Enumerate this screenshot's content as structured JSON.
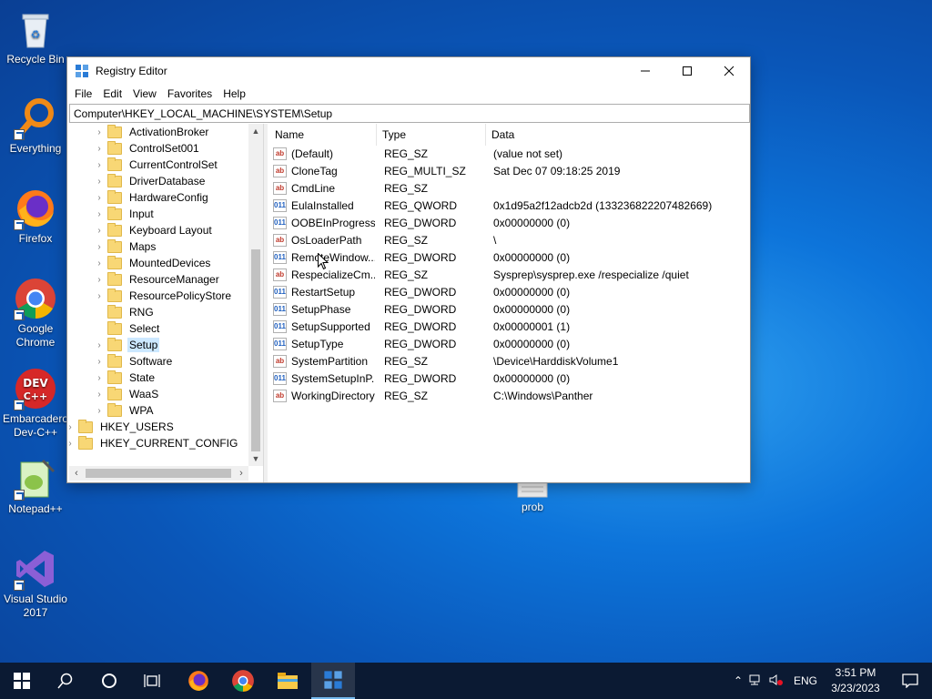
{
  "desktop": {
    "icons": [
      {
        "label": "Recycle Bin"
      },
      {
        "label": "Everything"
      },
      {
        "label": "Firefox"
      },
      {
        "label": "Google Chrome"
      },
      {
        "label": "Embarcadero Dev-C++"
      },
      {
        "label": "Notepad++"
      },
      {
        "label": "Visual Studio 2017"
      },
      {
        "label": "prob"
      }
    ]
  },
  "window": {
    "title": "Registry Editor",
    "menu": [
      "File",
      "Edit",
      "View",
      "Favorites",
      "Help"
    ],
    "address": "Computer\\HKEY_LOCAL_MACHINE\\SYSTEM\\Setup",
    "tree": [
      {
        "label": "ActivationBroker"
      },
      {
        "label": "ControlSet001"
      },
      {
        "label": "CurrentControlSet"
      },
      {
        "label": "DriverDatabase"
      },
      {
        "label": "HardwareConfig"
      },
      {
        "label": "Input"
      },
      {
        "label": "Keyboard Layout"
      },
      {
        "label": "Maps"
      },
      {
        "label": "MountedDevices"
      },
      {
        "label": "ResourceManager"
      },
      {
        "label": "ResourcePolicyStore"
      },
      {
        "label": "RNG"
      },
      {
        "label": "Select"
      },
      {
        "label": "Setup",
        "selected": true
      },
      {
        "label": "Software"
      },
      {
        "label": "State"
      },
      {
        "label": "WaaS"
      },
      {
        "label": "WPA"
      },
      {
        "label": "HKEY_USERS"
      },
      {
        "label": "HKEY_CURRENT_CONFIG"
      }
    ],
    "columns": {
      "name": "Name",
      "type": "Type",
      "data": "Data"
    },
    "values": [
      {
        "icon": "string-value-icon",
        "name": "(Default)",
        "type": "REG_SZ",
        "data": "(value not set)"
      },
      {
        "icon": "string-value-icon",
        "name": "CloneTag",
        "type": "REG_MULTI_SZ",
        "data": "Sat Dec 07 09:18:25 2019"
      },
      {
        "icon": "string-value-icon",
        "name": "CmdLine",
        "type": "REG_SZ",
        "data": ""
      },
      {
        "icon": "binary-value-icon",
        "name": "EulaInstalled",
        "type": "REG_QWORD",
        "data": "0x1d95a2f12adcb2d (133236822207482669)"
      },
      {
        "icon": "binary-value-icon",
        "name": "OOBEInProgress",
        "type": "REG_DWORD",
        "data": "0x00000000 (0)"
      },
      {
        "icon": "string-value-icon",
        "name": "OsLoaderPath",
        "type": "REG_SZ",
        "data": "\\"
      },
      {
        "icon": "binary-value-icon",
        "name": "RemoteWindow...",
        "type": "REG_DWORD",
        "data": "0x00000000 (0)"
      },
      {
        "icon": "string-value-icon",
        "name": "RespecializeCm...",
        "type": "REG_SZ",
        "data": "Sysprep\\sysprep.exe /respecialize /quiet"
      },
      {
        "icon": "binary-value-icon",
        "name": "RestartSetup",
        "type": "REG_DWORD",
        "data": "0x00000000 (0)"
      },
      {
        "icon": "binary-value-icon",
        "name": "SetupPhase",
        "type": "REG_DWORD",
        "data": "0x00000000 (0)"
      },
      {
        "icon": "binary-value-icon",
        "name": "SetupSupported",
        "type": "REG_DWORD",
        "data": "0x00000001 (1)"
      },
      {
        "icon": "binary-value-icon",
        "name": "SetupType",
        "type": "REG_DWORD",
        "data": "0x00000000 (0)"
      },
      {
        "icon": "string-value-icon",
        "name": "SystemPartition",
        "type": "REG_SZ",
        "data": "\\Device\\HarddiskVolume1"
      },
      {
        "icon": "binary-value-icon",
        "name": "SystemSetupInP...",
        "type": "REG_DWORD",
        "data": "0x00000000 (0)"
      },
      {
        "icon": "string-value-icon",
        "name": "WorkingDirectory",
        "type": "REG_SZ",
        "data": "C:\\Windows\\Panther"
      }
    ]
  },
  "taskbar": {
    "tray": {
      "language": "ENG",
      "time": "3:51 PM",
      "date": "3/23/2023"
    }
  }
}
